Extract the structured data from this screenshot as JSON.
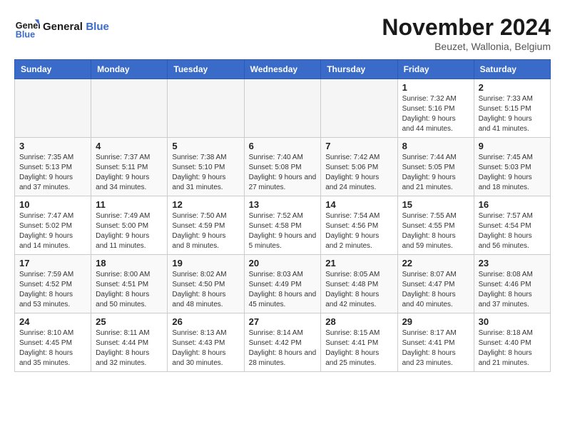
{
  "logo": {
    "line1": "General",
    "line2": "Blue"
  },
  "title": "November 2024",
  "subtitle": "Beuzet, Wallonia, Belgium",
  "headers": [
    "Sunday",
    "Monday",
    "Tuesday",
    "Wednesday",
    "Thursday",
    "Friday",
    "Saturday"
  ],
  "weeks": [
    [
      {
        "day": "",
        "detail": ""
      },
      {
        "day": "",
        "detail": ""
      },
      {
        "day": "",
        "detail": ""
      },
      {
        "day": "",
        "detail": ""
      },
      {
        "day": "",
        "detail": ""
      },
      {
        "day": "1",
        "detail": "Sunrise: 7:32 AM\nSunset: 5:16 PM\nDaylight: 9 hours and 44 minutes."
      },
      {
        "day": "2",
        "detail": "Sunrise: 7:33 AM\nSunset: 5:15 PM\nDaylight: 9 hours and 41 minutes."
      }
    ],
    [
      {
        "day": "3",
        "detail": "Sunrise: 7:35 AM\nSunset: 5:13 PM\nDaylight: 9 hours and 37 minutes."
      },
      {
        "day": "4",
        "detail": "Sunrise: 7:37 AM\nSunset: 5:11 PM\nDaylight: 9 hours and 34 minutes."
      },
      {
        "day": "5",
        "detail": "Sunrise: 7:38 AM\nSunset: 5:10 PM\nDaylight: 9 hours and 31 minutes."
      },
      {
        "day": "6",
        "detail": "Sunrise: 7:40 AM\nSunset: 5:08 PM\nDaylight: 9 hours and 27 minutes."
      },
      {
        "day": "7",
        "detail": "Sunrise: 7:42 AM\nSunset: 5:06 PM\nDaylight: 9 hours and 24 minutes."
      },
      {
        "day": "8",
        "detail": "Sunrise: 7:44 AM\nSunset: 5:05 PM\nDaylight: 9 hours and 21 minutes."
      },
      {
        "day": "9",
        "detail": "Sunrise: 7:45 AM\nSunset: 5:03 PM\nDaylight: 9 hours and 18 minutes."
      }
    ],
    [
      {
        "day": "10",
        "detail": "Sunrise: 7:47 AM\nSunset: 5:02 PM\nDaylight: 9 hours and 14 minutes."
      },
      {
        "day": "11",
        "detail": "Sunrise: 7:49 AM\nSunset: 5:00 PM\nDaylight: 9 hours and 11 minutes."
      },
      {
        "day": "12",
        "detail": "Sunrise: 7:50 AM\nSunset: 4:59 PM\nDaylight: 9 hours and 8 minutes."
      },
      {
        "day": "13",
        "detail": "Sunrise: 7:52 AM\nSunset: 4:58 PM\nDaylight: 9 hours and 5 minutes."
      },
      {
        "day": "14",
        "detail": "Sunrise: 7:54 AM\nSunset: 4:56 PM\nDaylight: 9 hours and 2 minutes."
      },
      {
        "day": "15",
        "detail": "Sunrise: 7:55 AM\nSunset: 4:55 PM\nDaylight: 8 hours and 59 minutes."
      },
      {
        "day": "16",
        "detail": "Sunrise: 7:57 AM\nSunset: 4:54 PM\nDaylight: 8 hours and 56 minutes."
      }
    ],
    [
      {
        "day": "17",
        "detail": "Sunrise: 7:59 AM\nSunset: 4:52 PM\nDaylight: 8 hours and 53 minutes."
      },
      {
        "day": "18",
        "detail": "Sunrise: 8:00 AM\nSunset: 4:51 PM\nDaylight: 8 hours and 50 minutes."
      },
      {
        "day": "19",
        "detail": "Sunrise: 8:02 AM\nSunset: 4:50 PM\nDaylight: 8 hours and 48 minutes."
      },
      {
        "day": "20",
        "detail": "Sunrise: 8:03 AM\nSunset: 4:49 PM\nDaylight: 8 hours and 45 minutes."
      },
      {
        "day": "21",
        "detail": "Sunrise: 8:05 AM\nSunset: 4:48 PM\nDaylight: 8 hours and 42 minutes."
      },
      {
        "day": "22",
        "detail": "Sunrise: 8:07 AM\nSunset: 4:47 PM\nDaylight: 8 hours and 40 minutes."
      },
      {
        "day": "23",
        "detail": "Sunrise: 8:08 AM\nSunset: 4:46 PM\nDaylight: 8 hours and 37 minutes."
      }
    ],
    [
      {
        "day": "24",
        "detail": "Sunrise: 8:10 AM\nSunset: 4:45 PM\nDaylight: 8 hours and 35 minutes."
      },
      {
        "day": "25",
        "detail": "Sunrise: 8:11 AM\nSunset: 4:44 PM\nDaylight: 8 hours and 32 minutes."
      },
      {
        "day": "26",
        "detail": "Sunrise: 8:13 AM\nSunset: 4:43 PM\nDaylight: 8 hours and 30 minutes."
      },
      {
        "day": "27",
        "detail": "Sunrise: 8:14 AM\nSunset: 4:42 PM\nDaylight: 8 hours and 28 minutes."
      },
      {
        "day": "28",
        "detail": "Sunrise: 8:15 AM\nSunset: 4:41 PM\nDaylight: 8 hours and 25 minutes."
      },
      {
        "day": "29",
        "detail": "Sunrise: 8:17 AM\nSunset: 4:41 PM\nDaylight: 8 hours and 23 minutes."
      },
      {
        "day": "30",
        "detail": "Sunrise: 8:18 AM\nSunset: 4:40 PM\nDaylight: 8 hours and 21 minutes."
      }
    ]
  ]
}
